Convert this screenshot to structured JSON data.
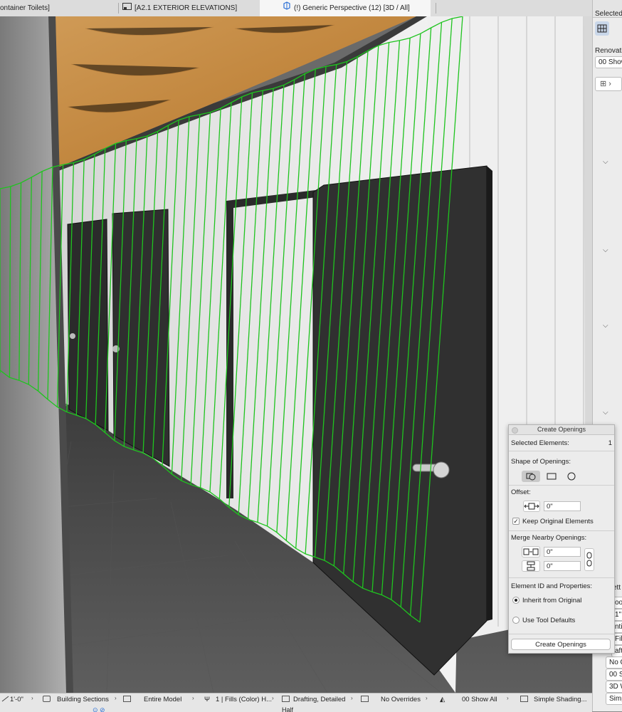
{
  "tabs": [
    {
      "label": "ontainer Toilets]",
      "active": false
    },
    {
      "label": "[A2.1 EXTERIOR ELEVATIONS]",
      "active": false
    },
    {
      "label": "(!) Generic Perspective (12) [3D / All]",
      "active": true
    }
  ],
  "info_panel": {
    "selected_label": "Selected",
    "renovation_label": "Renovatio",
    "renovation_value": "00 Show",
    "truncated_values": [
      "ett",
      "oor",
      "1\"",
      "ntire",
      "Fil",
      "aft",
      "No O",
      "00 Sh",
      "3D W",
      "Simp"
    ]
  },
  "dialog": {
    "title": "Create Openings",
    "selected_elements_label": "Selected Elements:",
    "selected_elements_value": "1",
    "shape_label": "Shape of Openings:",
    "offset_label": "Offset:",
    "offset_value": "0\"",
    "keep_original_label": "Keep Original Elements",
    "keep_original_checked": true,
    "merge_label": "Merge Nearby Openings:",
    "merge_value_1": "0\"",
    "merge_value_2": "0\"",
    "element_id_label": "Element ID and Properties:",
    "inherit_label": "Inherit from Original",
    "tool_defaults_label": "Use Tool Defaults",
    "selected_option": "inherit",
    "create_button": "Create Openings"
  },
  "statusbar": {
    "scale": "1'-0\"",
    "building_sections": "Building Sections",
    "model": "Entire Model",
    "fills": "1 | Fills (Color) H...",
    "drafting": "Drafting, Detailed",
    "overrides": "No Overrides",
    "show_all": "00 Show All",
    "shading": "Simple Shading...",
    "zoom": "Half"
  },
  "colors": {
    "accent": "#2a6fd6",
    "selection_green": "#1fc41f",
    "door_dark": "#2a2a2a",
    "ceiling_wood": "#c8924a"
  }
}
